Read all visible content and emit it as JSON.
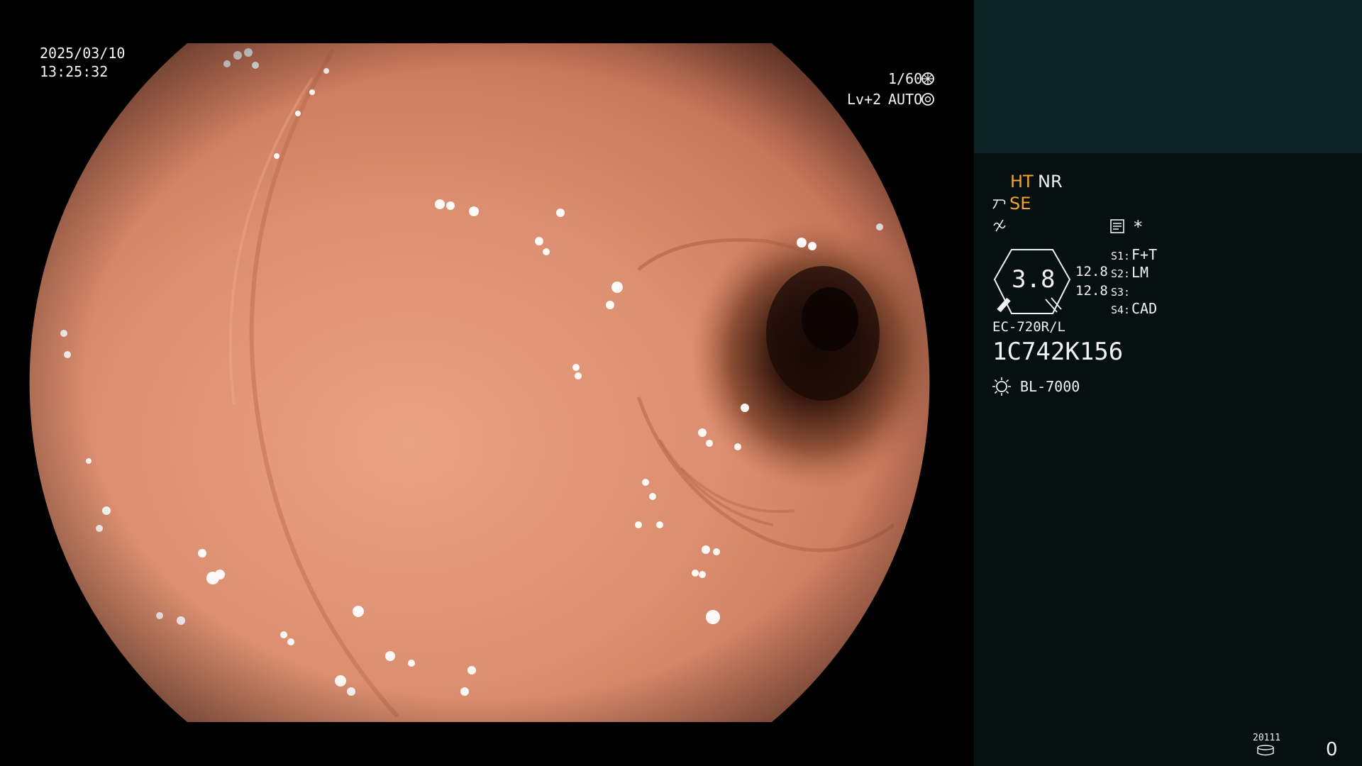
{
  "overlay": {
    "date": "2025/03/10",
    "time": "13:25:32",
    "shutter": "1/60",
    "level": "Lv+2",
    "iris": "AUTO"
  },
  "panel": {
    "mode_ht": "HT",
    "mode_nr": "NR",
    "mode_se": "SE",
    "magnification": "3.8",
    "value_top": "12.8",
    "value_bottom": "12.8",
    "switches": [
      {
        "key": "S1:",
        "value": "F+T"
      },
      {
        "key": "S2:",
        "value": "LM"
      },
      {
        "key": "S3:",
        "value": ""
      },
      {
        "key": "S4:",
        "value": "CAD"
      }
    ],
    "asterisk": "*",
    "scope_model": "EC-720R/L",
    "scope_serial": "1C742K156",
    "light_source": "BL-7000",
    "counter_label": "20111",
    "counter_value": "0"
  },
  "colors": {
    "panel_bg": "#071010",
    "panel_top_bg": "#0c2426",
    "accent_orange": "#f2a531",
    "mucosa": "#d98a6a"
  },
  "icons": [
    "shutter-icon",
    "iris-icon",
    "scope-bend-icon",
    "function-icon",
    "memo-icon",
    "lamp-icon",
    "storage-icon"
  ]
}
